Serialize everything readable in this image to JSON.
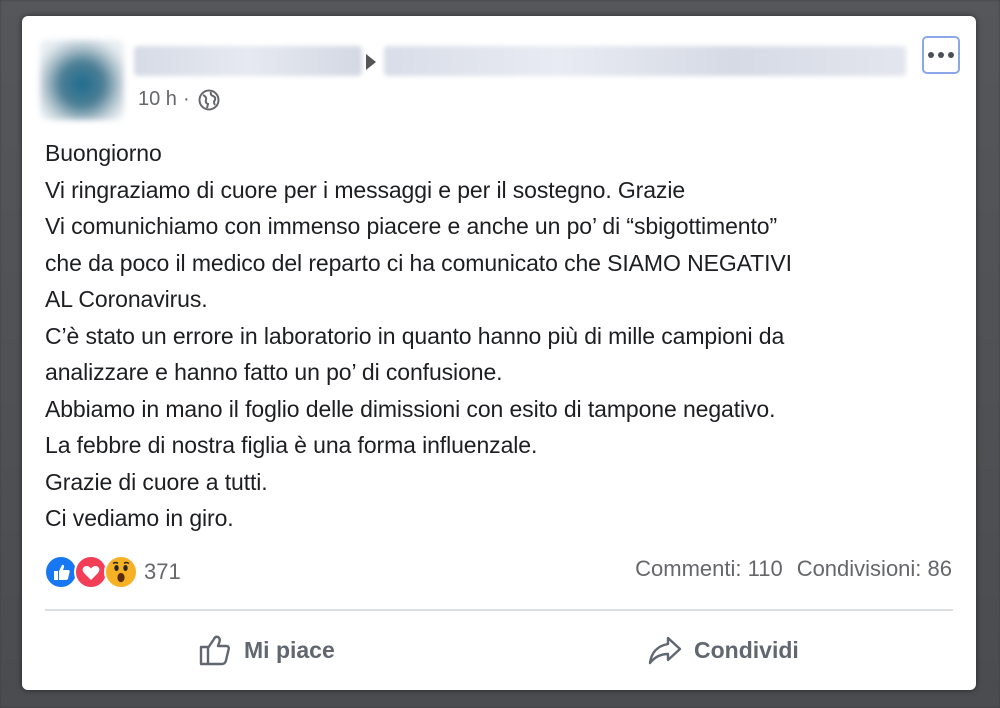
{
  "post": {
    "time": "10 h",
    "separator": "·",
    "lines": [
      "Buongiorno",
      "Vi ringraziamo di cuore per i messaggi e per il sostegno. Grazie",
      "Vi comunichiamo con immenso piacere e anche un po’ di “sbigottimento”",
      "che da poco il medico del reparto ci ha comunicato che SIAMO NEGATIVI",
      "AL Coronavirus.",
      "C’è stato un errore in laboratorio in quanto hanno più di mille campioni da",
      "analizzare e hanno fatto un po’ di confusione.",
      "Abbiamo in mano il foglio delle dimissioni con esito di tampone negativo.",
      "La febbre di nostra figlia è una forma influenzale.",
      "Grazie di cuore a tutti.",
      "Ci vediamo in giro."
    ]
  },
  "reactions": {
    "types": [
      "like-icon",
      "love-icon",
      "wow-icon"
    ],
    "count": "371"
  },
  "stats": {
    "comments": "Commenti: 110",
    "shares": "Condivisioni: 86"
  },
  "actions": {
    "like_label": "Mi piace",
    "share_label": "Condividi"
  },
  "colors": {
    "like_blue": "#1877f2",
    "love_red": "#f33e58",
    "wow_yellow": "#f7b125",
    "text": "#1c1e21",
    "secondary": "#65676b"
  }
}
